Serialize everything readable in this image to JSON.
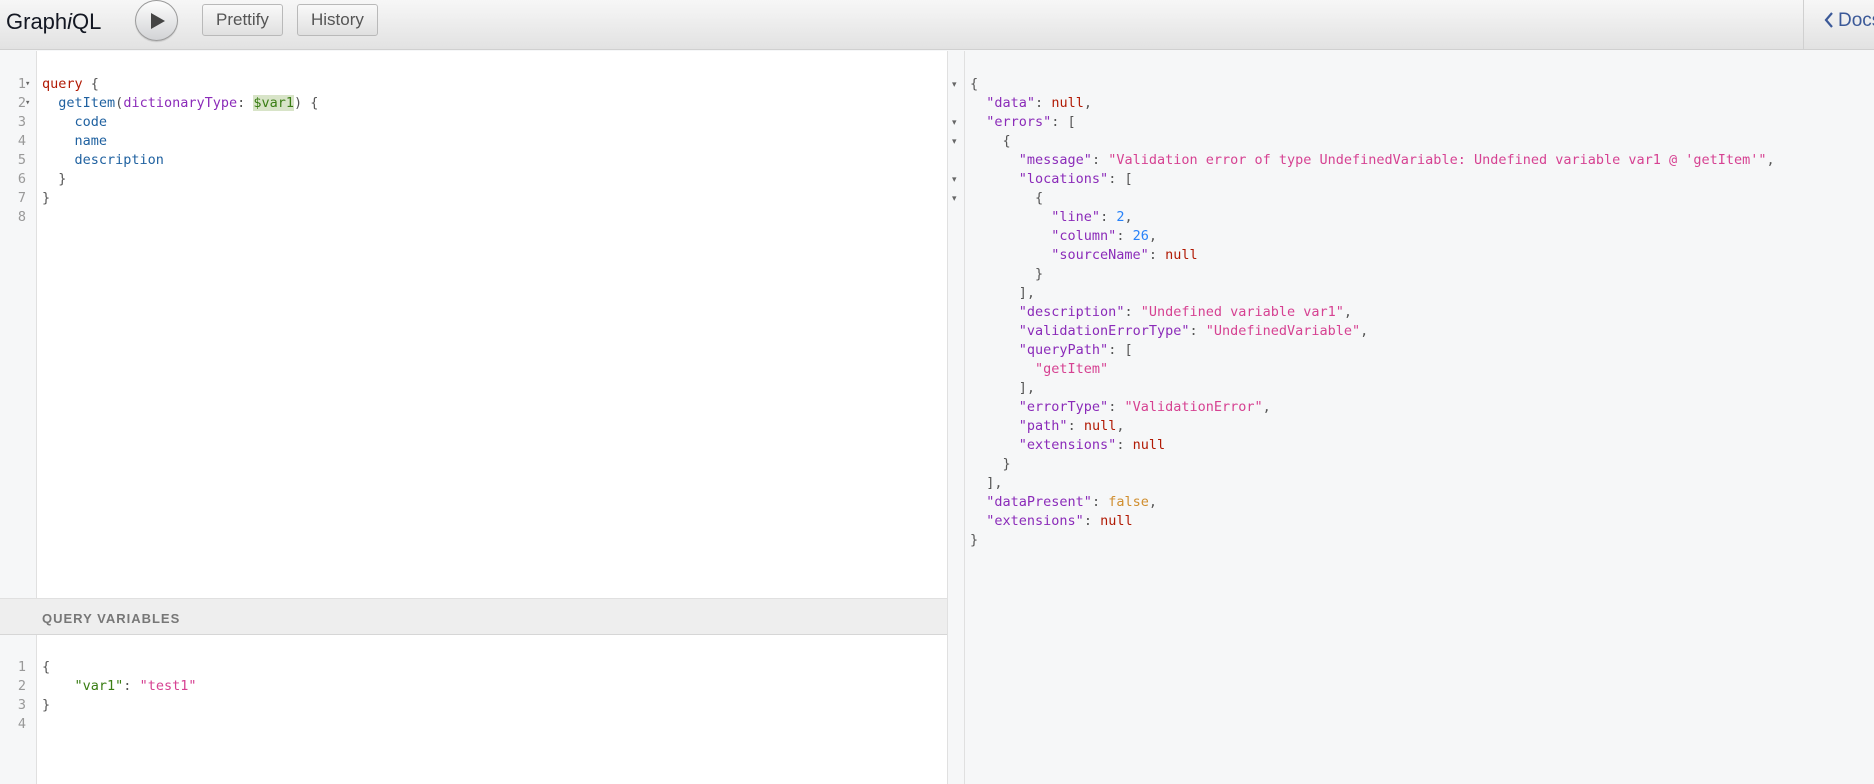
{
  "header": {
    "title_prefix": "Graph",
    "title_italic": "i",
    "title_suffix": "QL",
    "prettify_label": "Prettify",
    "history_label": "History",
    "docs_label": "Docs"
  },
  "query_editor": {
    "line_numbers": [
      "1",
      "2",
      "3",
      "4",
      "5",
      "6",
      "7",
      "8"
    ],
    "lines": [
      [
        {
          "t": "query",
          "c": "k"
        },
        {
          "t": " {",
          "c": "pn"
        }
      ],
      [
        {
          "t": "  "
        },
        {
          "t": "getItem",
          "c": "pr"
        },
        {
          "t": "(",
          "c": "pn"
        },
        {
          "t": "dictionaryType",
          "c": "at"
        },
        {
          "t": ": ",
          "c": "pn"
        },
        {
          "t": "$var1",
          "c": "var"
        },
        {
          "t": ") {",
          "c": "pn"
        }
      ],
      [
        {
          "t": "    "
        },
        {
          "t": "code",
          "c": "pr"
        }
      ],
      [
        {
          "t": "    "
        },
        {
          "t": "name",
          "c": "pr"
        }
      ],
      [
        {
          "t": "    "
        },
        {
          "t": "description",
          "c": "pr"
        }
      ],
      [
        {
          "t": "  }",
          "c": "pn"
        }
      ],
      [
        {
          "t": "}",
          "c": "pn"
        }
      ],
      []
    ]
  },
  "variables": {
    "title": "QUERY VARIABLES",
    "line_numbers": [
      "1",
      "2",
      "3",
      "4"
    ],
    "lines": [
      [
        {
          "t": "{",
          "c": "pn"
        }
      ],
      [
        {
          "t": "    "
        },
        {
          "t": "\"var1\"",
          "c": "def"
        },
        {
          "t": ": ",
          "c": "pn"
        },
        {
          "t": "\"test1\"",
          "c": "str"
        }
      ],
      [
        {
          "t": "}",
          "c": "pn"
        }
      ],
      []
    ]
  },
  "result": {
    "lines": [
      [
        {
          "t": "{",
          "c": "pn"
        }
      ],
      [
        {
          "t": "  "
        },
        {
          "t": "\"data\"",
          "c": "at"
        },
        {
          "t": ": ",
          "c": "pn"
        },
        {
          "t": "null",
          "c": "kw"
        },
        {
          "t": ",",
          "c": "pn"
        }
      ],
      [
        {
          "t": "  "
        },
        {
          "t": "\"errors\"",
          "c": "at"
        },
        {
          "t": ": [",
          "c": "pn"
        }
      ],
      [
        {
          "t": "    "
        },
        {
          "t": "{",
          "c": "pn"
        }
      ],
      [
        {
          "t": "      "
        },
        {
          "t": "\"message\"",
          "c": "at"
        },
        {
          "t": ": ",
          "c": "pn"
        },
        {
          "t": "\"Validation error of type UndefinedVariable: Undefined variable var1 @ 'getItem'\"",
          "c": "str"
        },
        {
          "t": ",",
          "c": "pn"
        }
      ],
      [
        {
          "t": "      "
        },
        {
          "t": "\"locations\"",
          "c": "at"
        },
        {
          "t": ": [",
          "c": "pn"
        }
      ],
      [
        {
          "t": "        "
        },
        {
          "t": "{",
          "c": "pn"
        }
      ],
      [
        {
          "t": "          "
        },
        {
          "t": "\"line\"",
          "c": "at"
        },
        {
          "t": ": ",
          "c": "pn"
        },
        {
          "t": "2",
          "c": "num"
        },
        {
          "t": ",",
          "c": "pn"
        }
      ],
      [
        {
          "t": "          "
        },
        {
          "t": "\"column\"",
          "c": "at"
        },
        {
          "t": ": ",
          "c": "pn"
        },
        {
          "t": "26",
          "c": "num"
        },
        {
          "t": ",",
          "c": "pn"
        }
      ],
      [
        {
          "t": "          "
        },
        {
          "t": "\"sourceName\"",
          "c": "at"
        },
        {
          "t": ": ",
          "c": "pn"
        },
        {
          "t": "null",
          "c": "kw"
        }
      ],
      [
        {
          "t": "        "
        },
        {
          "t": "}",
          "c": "pn"
        }
      ],
      [
        {
          "t": "      "
        },
        {
          "t": "],",
          "c": "pn"
        }
      ],
      [
        {
          "t": "      "
        },
        {
          "t": "\"description\"",
          "c": "at"
        },
        {
          "t": ": ",
          "c": "pn"
        },
        {
          "t": "\"Undefined variable var1\"",
          "c": "str"
        },
        {
          "t": ",",
          "c": "pn"
        }
      ],
      [
        {
          "t": "      "
        },
        {
          "t": "\"validationErrorType\"",
          "c": "at"
        },
        {
          "t": ": ",
          "c": "pn"
        },
        {
          "t": "\"UndefinedVariable\"",
          "c": "str"
        },
        {
          "t": ",",
          "c": "pn"
        }
      ],
      [
        {
          "t": "      "
        },
        {
          "t": "\"queryPath\"",
          "c": "at"
        },
        {
          "t": ": [",
          "c": "pn"
        }
      ],
      [
        {
          "t": "        "
        },
        {
          "t": "\"getItem\"",
          "c": "str"
        }
      ],
      [
        {
          "t": "      "
        },
        {
          "t": "],",
          "c": "pn"
        }
      ],
      [
        {
          "t": "      "
        },
        {
          "t": "\"errorType\"",
          "c": "at"
        },
        {
          "t": ": ",
          "c": "pn"
        },
        {
          "t": "\"ValidationError\"",
          "c": "str"
        },
        {
          "t": ",",
          "c": "pn"
        }
      ],
      [
        {
          "t": "      "
        },
        {
          "t": "\"path\"",
          "c": "at"
        },
        {
          "t": ": ",
          "c": "pn"
        },
        {
          "t": "null",
          "c": "kw"
        },
        {
          "t": ",",
          "c": "pn"
        }
      ],
      [
        {
          "t": "      "
        },
        {
          "t": "\"extensions\"",
          "c": "at"
        },
        {
          "t": ": ",
          "c": "pn"
        },
        {
          "t": "null",
          "c": "kw"
        }
      ],
      [
        {
          "t": "    "
        },
        {
          "t": "}",
          "c": "pn"
        }
      ],
      [
        {
          "t": "  "
        },
        {
          "t": "],",
          "c": "pn"
        }
      ],
      [
        {
          "t": "  "
        },
        {
          "t": "\"dataPresent\"",
          "c": "at"
        },
        {
          "t": ": ",
          "c": "pn"
        },
        {
          "t": "false",
          "c": "bool"
        },
        {
          "t": ",",
          "c": "pn"
        }
      ],
      [
        {
          "t": "  "
        },
        {
          "t": "\"extensions\"",
          "c": "at"
        },
        {
          "t": ": ",
          "c": "pn"
        },
        {
          "t": "null",
          "c": "kw"
        }
      ],
      [
        {
          "t": "}",
          "c": "pn"
        }
      ]
    ]
  }
}
